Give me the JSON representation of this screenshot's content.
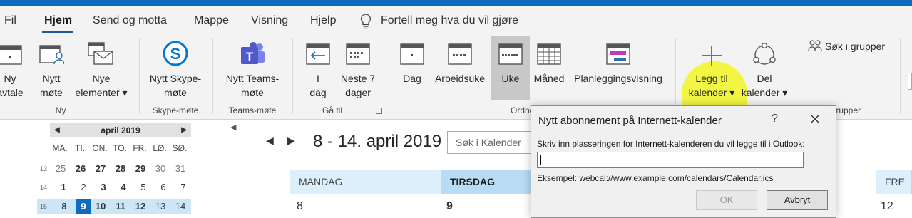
{
  "menu": {
    "tabs": [
      "Fil",
      "Hjem",
      "Send og motta",
      "Mappe",
      "Visning",
      "Hjelp"
    ],
    "active_tab": "Hjem",
    "tell_me": "Fortell meg hva du vil gjøre"
  },
  "ribbon": {
    "ny": {
      "new_appointment": [
        "Ny",
        "avtale"
      ],
      "new_meeting": [
        "Nytt",
        "møte"
      ],
      "new_items": [
        "Nye",
        "elementer ▾"
      ],
      "group": "Ny"
    },
    "skype": {
      "button": [
        "Nytt Skype-",
        "møte"
      ],
      "group": "Skype-møte"
    },
    "teams": {
      "button": [
        "Nytt Teams-",
        "møte"
      ],
      "group": "Teams-møte"
    },
    "goto": {
      "today": [
        "I",
        "dag"
      ],
      "next7": [
        "Neste 7",
        "dager"
      ],
      "group": "Gå til"
    },
    "arrange": {
      "day": "Dag",
      "workweek": "Arbeidsuke",
      "week": "Uke",
      "month": "Måned",
      "schedule": "Planleggingsvisning",
      "group": "Ordne"
    },
    "manage": {
      "add_calendar": [
        "Legg til",
        "kalender ▾"
      ],
      "share_calendar": [
        "Del",
        "kalender ▾"
      ]
    },
    "groups": {
      "search": "Søk i grupper",
      "group": "Grupper"
    }
  },
  "mini_calendar": {
    "month_label": "april 2019",
    "weekdays": [
      "MA.",
      "TI.",
      "ON.",
      "TO.",
      "FR.",
      "LØ.",
      "SØ."
    ],
    "weeks": [
      {
        "num": "13",
        "days": [
          "25",
          "26",
          "27",
          "28",
          "29",
          "30",
          "31"
        ]
      },
      {
        "num": "14",
        "days": [
          "1",
          "2",
          "3",
          "4",
          "5",
          "6",
          "7"
        ]
      },
      {
        "num": "15",
        "days": [
          "8",
          "9",
          "10",
          "11",
          "12",
          "13",
          "14"
        ]
      }
    ]
  },
  "calendar": {
    "range_title": "8 - 14. april 2019",
    "search_placeholder": "Søk i Kalender",
    "day_headers": {
      "monday": "MANDAG",
      "tuesday": "TIRSDAG",
      "friday": "FRE"
    },
    "day_numbers": {
      "monday": "8",
      "tuesday": "9",
      "friday": "12"
    }
  },
  "dialog": {
    "title": "Nytt abonnement på Internett-kalender",
    "help": "?",
    "prompt": "Skriv inn plasseringen for Internett-kalenderen du vil legge til i Outlook:",
    "input_value": "",
    "example": "Eksempel: webcal://www.example.com/calendars/Calendar.ics",
    "ok_label": "OK",
    "cancel_label": "Avbryt"
  },
  "colors": {
    "accent": "#0f6cbd",
    "highlight": "#f2f71c",
    "today_header": "#b9dcf5",
    "add_icon": "#2e9e45"
  }
}
